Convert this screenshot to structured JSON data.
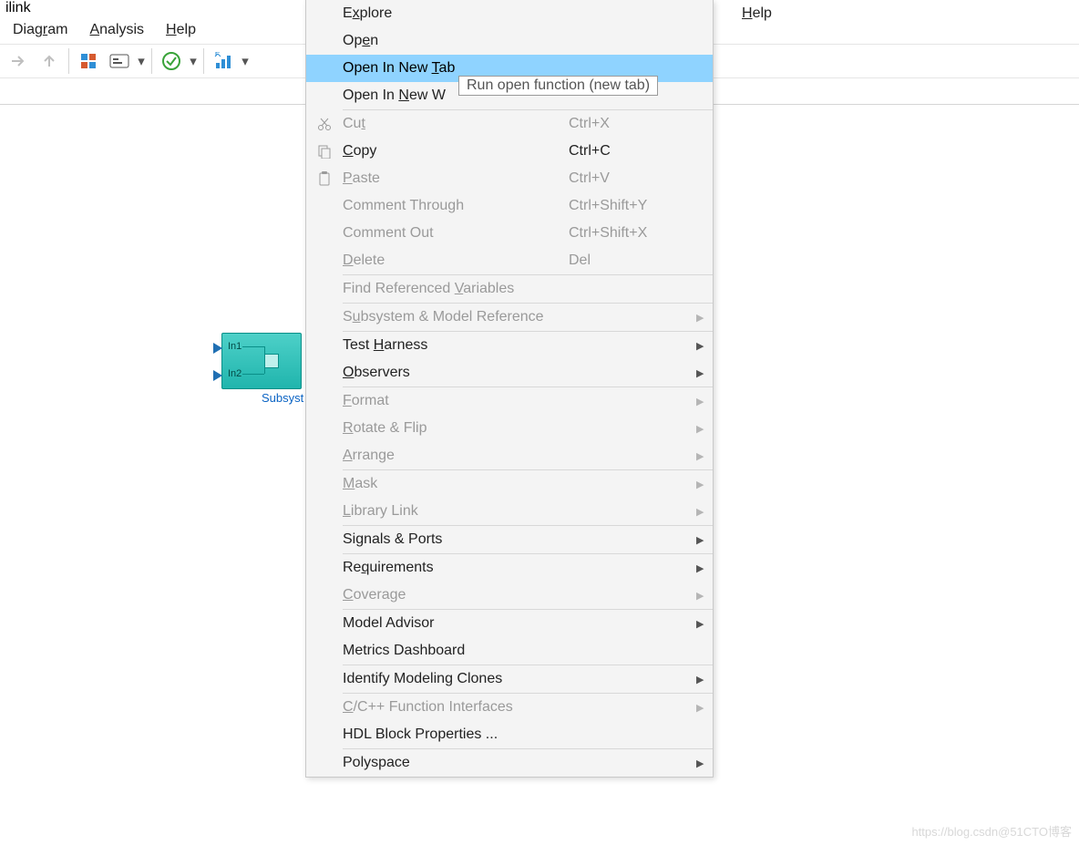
{
  "title": "ilink",
  "menubar": {
    "diagram": {
      "pre": "Diag",
      "u": "r",
      "post": "am"
    },
    "analysis": {
      "pre": "",
      "u": "A",
      "post": "nalysis"
    },
    "help": {
      "pre": "",
      "u": "H",
      "post": "elp"
    }
  },
  "help_top": {
    "pre": "",
    "u": "H",
    "post": "elp"
  },
  "block": {
    "in1": "In1",
    "in2": "In2",
    "label": "Subsyst"
  },
  "tooltip": "Run open function (new tab)",
  "ctx": [
    {
      "type": "item",
      "state": "en",
      "icon": "",
      "label": {
        "pre": "E",
        "u": "x",
        "post": "plore"
      },
      "sc": "",
      "sub": false
    },
    {
      "type": "item",
      "state": "en",
      "icon": "",
      "label": {
        "pre": "Op",
        "u": "e",
        "post": "n"
      },
      "sc": "",
      "sub": false
    },
    {
      "type": "item",
      "state": "hl",
      "icon": "",
      "label": {
        "pre": "Open In New ",
        "u": "T",
        "post": "ab"
      },
      "sc": "",
      "sub": false
    },
    {
      "type": "item",
      "state": "en",
      "icon": "",
      "label": {
        "pre": "Open In ",
        "u": "N",
        "post": "ew W"
      },
      "sc": "",
      "sub": false
    },
    {
      "type": "sep"
    },
    {
      "type": "item",
      "state": "dis",
      "icon": "cut",
      "label": {
        "pre": "Cu",
        "u": "t",
        "post": ""
      },
      "sc": "Ctrl+X",
      "sub": false
    },
    {
      "type": "item",
      "state": "en",
      "icon": "copy",
      "label": {
        "pre": "",
        "u": "C",
        "post": "opy"
      },
      "sc": "Ctrl+C",
      "sub": false
    },
    {
      "type": "item",
      "state": "dis",
      "icon": "paste",
      "label": {
        "pre": "",
        "u": "P",
        "post": "aste"
      },
      "sc": "Ctrl+V",
      "sub": false
    },
    {
      "type": "item",
      "state": "dis",
      "icon": "",
      "label": {
        "pre": "Comment Through",
        "u": "",
        "post": ""
      },
      "sc": "Ctrl+Shift+Y",
      "sub": false
    },
    {
      "type": "item",
      "state": "dis",
      "icon": "",
      "label": {
        "pre": "Comment Out",
        "u": "",
        "post": ""
      },
      "sc": "Ctrl+Shift+X",
      "sub": false
    },
    {
      "type": "item",
      "state": "dis",
      "icon": "",
      "label": {
        "pre": "",
        "u": "D",
        "post": "elete"
      },
      "sc": "Del",
      "sub": false
    },
    {
      "type": "sep"
    },
    {
      "type": "item",
      "state": "dis",
      "icon": "",
      "label": {
        "pre": "Find Referenced ",
        "u": "V",
        "post": "ariables"
      },
      "sc": "",
      "sub": false
    },
    {
      "type": "sep"
    },
    {
      "type": "item",
      "state": "dis",
      "icon": "",
      "label": {
        "pre": "S",
        "u": "u",
        "post": "bsystem & Model Reference"
      },
      "sc": "",
      "sub": true
    },
    {
      "type": "sep"
    },
    {
      "type": "item",
      "state": "en",
      "icon": "",
      "label": {
        "pre": "Test ",
        "u": "H",
        "post": "arness"
      },
      "sc": "",
      "sub": true
    },
    {
      "type": "item",
      "state": "en",
      "icon": "",
      "label": {
        "pre": "",
        "u": "O",
        "post": "bservers"
      },
      "sc": "",
      "sub": true
    },
    {
      "type": "sep"
    },
    {
      "type": "item",
      "state": "dis",
      "icon": "",
      "label": {
        "pre": "",
        "u": "F",
        "post": "ormat"
      },
      "sc": "",
      "sub": true
    },
    {
      "type": "item",
      "state": "dis",
      "icon": "",
      "label": {
        "pre": "",
        "u": "R",
        "post": "otate & Flip"
      },
      "sc": "",
      "sub": true
    },
    {
      "type": "item",
      "state": "dis",
      "icon": "",
      "label": {
        "pre": "",
        "u": "A",
        "post": "rrange"
      },
      "sc": "",
      "sub": true
    },
    {
      "type": "sep"
    },
    {
      "type": "item",
      "state": "dis",
      "icon": "",
      "label": {
        "pre": "",
        "u": "M",
        "post": "ask"
      },
      "sc": "",
      "sub": true
    },
    {
      "type": "item",
      "state": "dis",
      "icon": "",
      "label": {
        "pre": "",
        "u": "L",
        "post": "ibrary Link"
      },
      "sc": "",
      "sub": true
    },
    {
      "type": "sep"
    },
    {
      "type": "item",
      "state": "en",
      "icon": "",
      "label": {
        "pre": "Signals & Ports",
        "u": "",
        "post": ""
      },
      "sc": "",
      "sub": true
    },
    {
      "type": "sep"
    },
    {
      "type": "item",
      "state": "en",
      "icon": "",
      "label": {
        "pre": "Re",
        "u": "q",
        "post": "uirements"
      },
      "sc": "",
      "sub": true
    },
    {
      "type": "item",
      "state": "dis",
      "icon": "",
      "label": {
        "pre": "",
        "u": "C",
        "post": "overage"
      },
      "sc": "",
      "sub": true
    },
    {
      "type": "sep"
    },
    {
      "type": "item",
      "state": "en",
      "icon": "",
      "label": {
        "pre": "Model Advisor",
        "u": "",
        "post": ""
      },
      "sc": "",
      "sub": true
    },
    {
      "type": "item",
      "state": "en",
      "icon": "",
      "label": {
        "pre": "Metrics Dashboard",
        "u": "",
        "post": ""
      },
      "sc": "",
      "sub": false
    },
    {
      "type": "sep"
    },
    {
      "type": "item",
      "state": "en",
      "icon": "",
      "label": {
        "pre": "Identify Modeling Clones",
        "u": "",
        "post": ""
      },
      "sc": "",
      "sub": true
    },
    {
      "type": "sep"
    },
    {
      "type": "item",
      "state": "dis",
      "icon": "",
      "label": {
        "pre": "",
        "u": "C",
        "post": "/C++ Function Interfaces"
      },
      "sc": "",
      "sub": true
    },
    {
      "type": "item",
      "state": "en",
      "icon": "",
      "label": {
        "pre": "HDL Block Properties ...",
        "u": "",
        "post": ""
      },
      "sc": "",
      "sub": false
    },
    {
      "type": "sep"
    },
    {
      "type": "item",
      "state": "en",
      "icon": "",
      "label": {
        "pre": "Polyspace",
        "u": "",
        "post": ""
      },
      "sc": "",
      "sub": true
    }
  ],
  "watermark": "https://blog.csdn@51CTO博客"
}
